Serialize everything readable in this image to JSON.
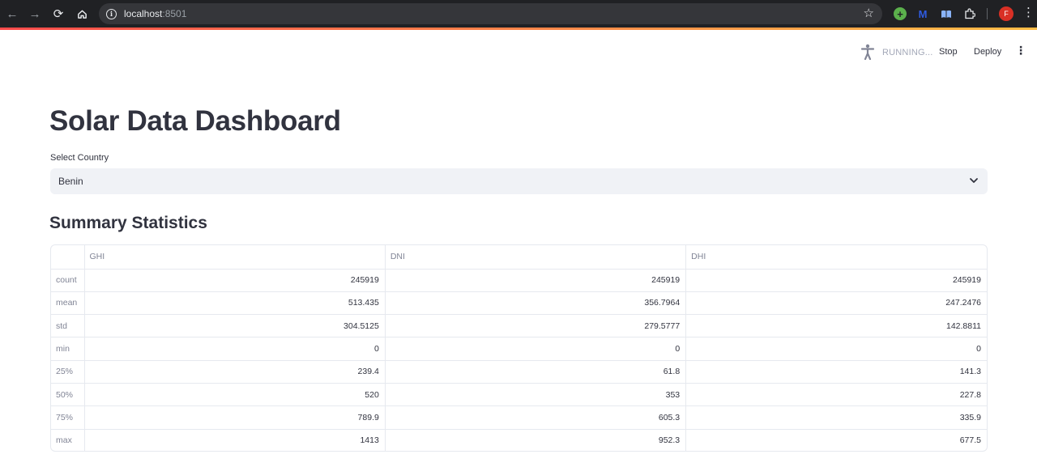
{
  "browser": {
    "url_host": "localhost",
    "url_port": ":8501",
    "profile_initial": "F"
  },
  "header": {
    "status": "RUNNING...",
    "stop_label": "Stop",
    "deploy_label": "Deploy"
  },
  "main": {
    "title": "Solar Data Dashboard",
    "select_label": "Select Country",
    "select_value": "Benin",
    "summary_title": "Summary Statistics"
  },
  "table": {
    "columns": [
      "",
      "GHI",
      "DNI",
      "DHI"
    ],
    "rows": [
      {
        "label": "count",
        "values": [
          "245919",
          "245919",
          "245919"
        ]
      },
      {
        "label": "mean",
        "values": [
          "513.435",
          "356.7964",
          "247.2476"
        ]
      },
      {
        "label": "std",
        "values": [
          "304.5125",
          "279.5777",
          "142.8811"
        ]
      },
      {
        "label": "min",
        "values": [
          "0",
          "0",
          "0"
        ]
      },
      {
        "label": "25%",
        "values": [
          "239.4",
          "61.8",
          "141.3"
        ]
      },
      {
        "label": "50%",
        "values": [
          "520",
          "353",
          "227.8"
        ]
      },
      {
        "label": "75%",
        "values": [
          "789.9",
          "605.3",
          "335.9"
        ]
      },
      {
        "label": "max",
        "values": [
          "1413",
          "952.3",
          "677.5"
        ]
      }
    ]
  },
  "colors": {
    "accent_red": "#ff4b4b",
    "accent_yellow": "#ffbd45",
    "text": "#31333f",
    "muted": "#808495"
  }
}
